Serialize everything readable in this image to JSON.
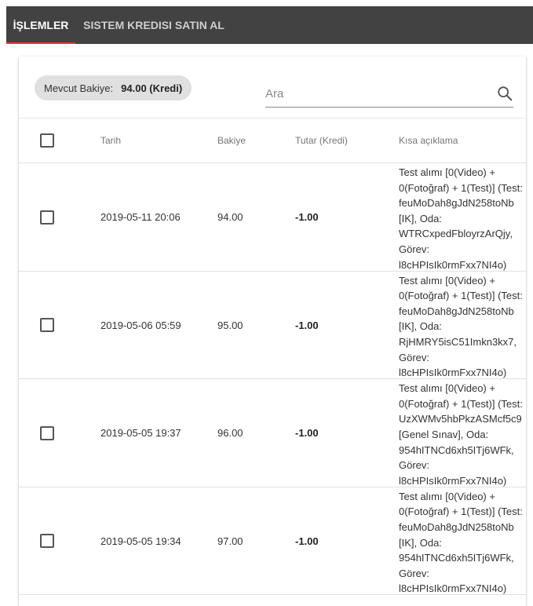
{
  "tabs": [
    {
      "label": "İŞLEMLER",
      "active": true
    },
    {
      "label": "SISTEM KREDISI SATIN AL",
      "active": false
    }
  ],
  "balance": {
    "label": "Mevcut Bakiye:",
    "value": "94.00 (Kredi)"
  },
  "search": {
    "placeholder": "Ara"
  },
  "table": {
    "headers": {
      "date": "Tarih",
      "balance": "Bakiye",
      "amount": "Tutar (Kredi)",
      "description": "Kısa açıklama"
    },
    "rows": [
      {
        "date": "2019-05-11 20:06",
        "balance": "94.00",
        "amount": "-1.00",
        "description_lines": [
          "Test alımı [0(Video) +",
          "0(Fotoğraf) + 1(Test)] (Test:",
          "feuMoDah8gJdN258toNb",
          "[IK], Oda:",
          "WTRCxpedFbloyrzArQjy,",
          "Görev:",
          "l8cHPIsIk0rmFxx7NI4o)"
        ]
      },
      {
        "date": "2019-05-06 05:59",
        "balance": "95.00",
        "amount": "-1.00",
        "description_lines": [
          "Test alımı [0(Video) +",
          "0(Fotoğraf) + 1(Test)] (Test:",
          "feuMoDah8gJdN258toNb",
          "[IK], Oda:",
          "RjHMRY5isC51Imkn3kx7,",
          "Görev:",
          "l8cHPIsIk0rmFxx7NI4o)"
        ]
      },
      {
        "date": "2019-05-05 19:37",
        "balance": "96.00",
        "amount": "-1.00",
        "description_lines": [
          "Test alımı [0(Video) +",
          "0(Fotoğraf) + 1(Test)] (Test:",
          "UzXWMv5hbPkzASMcf5c9",
          "[Genel Sınav], Oda:",
          "954hITNCd6xh5ITj6WFk,",
          "Görev:",
          "l8cHPIsIk0rmFxx7NI4o)"
        ]
      },
      {
        "date": "2019-05-05 19:34",
        "balance": "97.00",
        "amount": "-1.00",
        "description_lines": [
          "Test alımı [0(Video) +",
          "0(Fotoğraf) + 1(Test)] (Test:",
          "feuMoDah8gJdN258toNb",
          "[IK], Oda:",
          "954hITNCd6xh5ITj6WFk,",
          "Görev:",
          "l8cHPIsIk0rmFxx7NI4o)"
        ]
      }
    ]
  },
  "colors": {
    "tabbar_bg": "#424242",
    "tab_indicator": "#e53935",
    "chip_bg": "#e0e0e0"
  },
  "icons": {
    "search": "search-icon"
  }
}
